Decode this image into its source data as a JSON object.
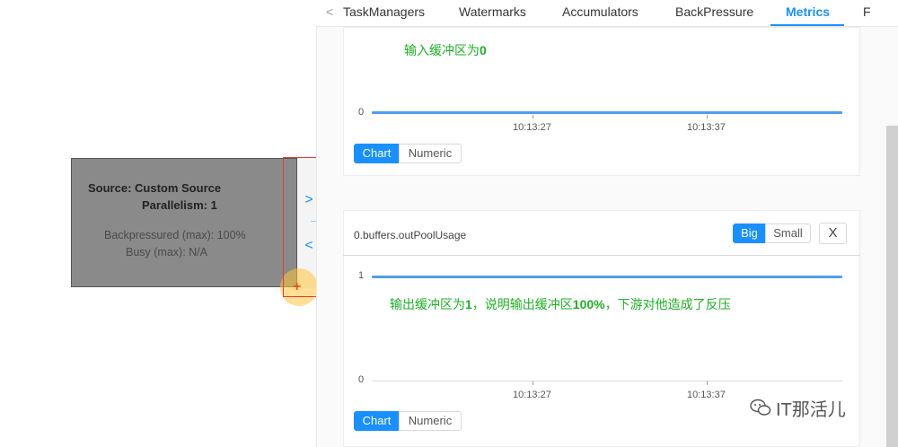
{
  "tabs": {
    "items": [
      {
        "label": "TaskManagers"
      },
      {
        "label": "Watermarks"
      },
      {
        "label": "Accumulators"
      },
      {
        "label": "BackPressure"
      },
      {
        "label": "Metrics"
      },
      {
        "label": "F"
      }
    ],
    "prev_icon": "chevron-left-icon",
    "prev_glyph": "<",
    "active_color": "#1890ff"
  },
  "node": {
    "name": "Source: Custom Source",
    "parallelism": "Parallelism: 1",
    "backpressured": "Backpressured (max): 100%",
    "busy": "Busy (max): N/A"
  },
  "toggles": {
    "expand_glyph": ">",
    "collapse_glyph": "<"
  },
  "cursor": {
    "glyph": "+"
  },
  "chart1": {
    "annotation_prefix": "输入缓冲区为",
    "annotation_value": "0",
    "y_label": "0",
    "x_labels": [
      "10:13:27",
      "10:13:37"
    ],
    "view_buttons": [
      {
        "label": "Chart"
      },
      {
        "label": "Numeric"
      }
    ]
  },
  "chart2": {
    "metric_name": "0.buffers.outPoolUsage",
    "size_buttons": [
      {
        "label": "Big"
      },
      {
        "label": "Small"
      }
    ],
    "close_glyph": "X",
    "y_labels": [
      "1",
      "0"
    ],
    "annotation_a": "输出缓冲区为",
    "annotation_b": "1",
    "annotation_c": "，说明输出缓冲区",
    "annotation_d": "100%",
    "annotation_e": "，下游对他造成了反压",
    "x_labels": [
      "10:13:27",
      "10:13:37"
    ],
    "view_buttons": [
      {
        "label": "Chart"
      },
      {
        "label": "Numeric"
      }
    ]
  },
  "chart_data": [
    {
      "type": "line",
      "title": "",
      "x": [
        "10:13:27",
        "10:13:37"
      ],
      "series": [
        {
          "values": [
            0,
            0
          ]
        }
      ],
      "ylim": [
        0,
        0
      ]
    },
    {
      "type": "line",
      "title": "0.buffers.outPoolUsage",
      "x": [
        "10:13:27",
        "10:13:37"
      ],
      "series": [
        {
          "values": [
            1,
            1
          ]
        }
      ],
      "ylim": [
        0,
        1
      ]
    }
  ],
  "watermark": {
    "text": "IT那活儿",
    "icon": "wechat-icon"
  }
}
